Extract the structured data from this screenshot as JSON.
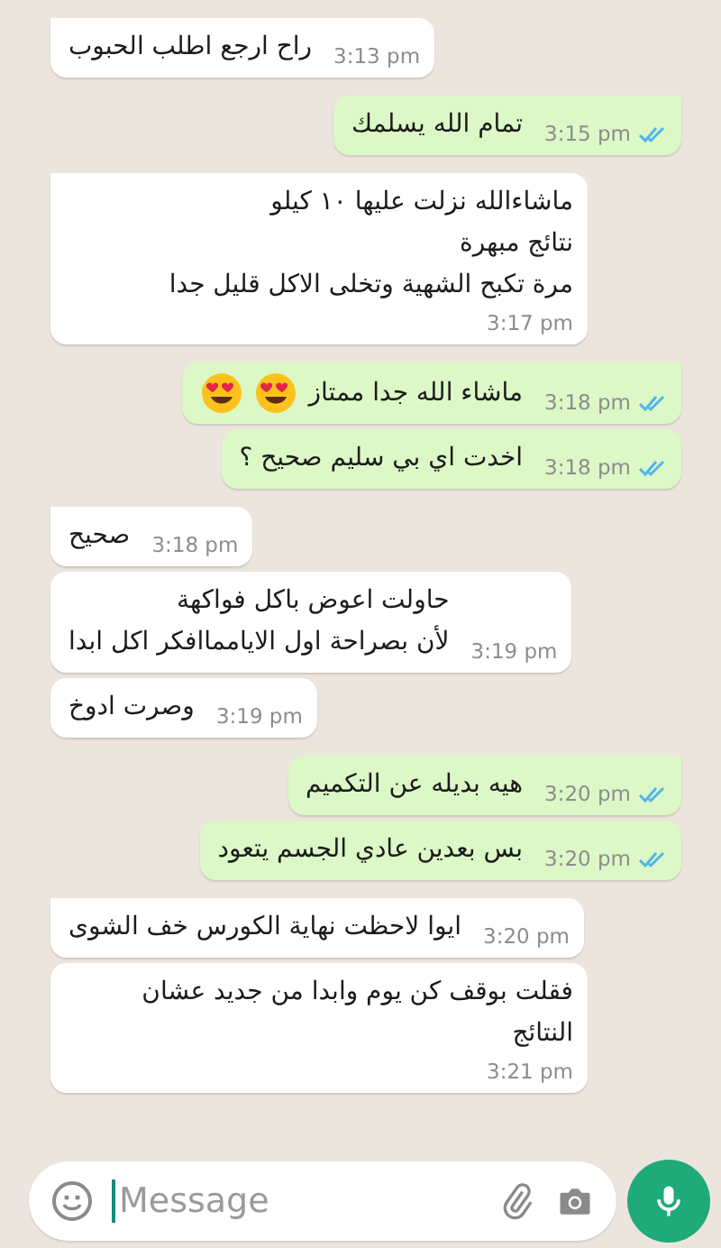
{
  "messages": [
    {
      "outgoing": false,
      "tail": true,
      "lines": [
        "راح ارجع اطلب الحبوب"
      ],
      "time": "3:13 pm"
    },
    {
      "outgoing": true,
      "tail": true,
      "lines": [
        "تمام الله يسلمك"
      ],
      "time": "3:15 pm",
      "read": true
    },
    {
      "outgoing": false,
      "tail": true,
      "lines": [
        "ماشاءالله نزلت عليها ١٠ كيلو",
        "نتائج مبهرة",
        "مرة تكبح الشهية وتخلى الاكل قليل جدا"
      ],
      "time": "3:17 pm"
    },
    {
      "outgoing": true,
      "tail": true,
      "lines": [
        "ماشاء الله جدا ممتاز"
      ],
      "emojis": [
        {
          "kind": "heart-eyes"
        },
        {
          "kind": "heart-eyes"
        }
      ],
      "time": "3:18 pm",
      "read": true
    },
    {
      "outgoing": true,
      "tail": false,
      "lines": [
        "اخدت اي بي سليم صحيح ؟"
      ],
      "time": "3:18 pm",
      "read": true
    },
    {
      "outgoing": false,
      "tail": true,
      "lines": [
        "صحيح"
      ],
      "time": "3:18 pm"
    },
    {
      "outgoing": false,
      "tail": false,
      "lines": [
        "حاولت اعوض باكل فواكهة",
        "لأن بصراحة اول الايامماافكر اكل ابدا"
      ],
      "time": "3:19 pm"
    },
    {
      "outgoing": false,
      "tail": false,
      "lines": [
        "وصرت ادوخ"
      ],
      "time": "3:19 pm"
    },
    {
      "outgoing": true,
      "tail": true,
      "lines": [
        "هيه بديله عن التكميم"
      ],
      "time": "3:20 pm",
      "read": true
    },
    {
      "outgoing": true,
      "tail": false,
      "lines": [
        "بس بعدين عادي الجسم يتعود"
      ],
      "time": "3:20 pm",
      "read": true
    },
    {
      "outgoing": false,
      "tail": true,
      "lines": [
        "ايوا لاحظت نهاية الكورس خف الشوى"
      ],
      "time": "3:20 pm"
    },
    {
      "outgoing": false,
      "tail": false,
      "lines": [
        "فقلت بوقف كن يوم وابدا من جديد عشان",
        "النتائج"
      ],
      "time": "3:21 pm"
    }
  ],
  "composer": {
    "placeholder": "Message"
  }
}
